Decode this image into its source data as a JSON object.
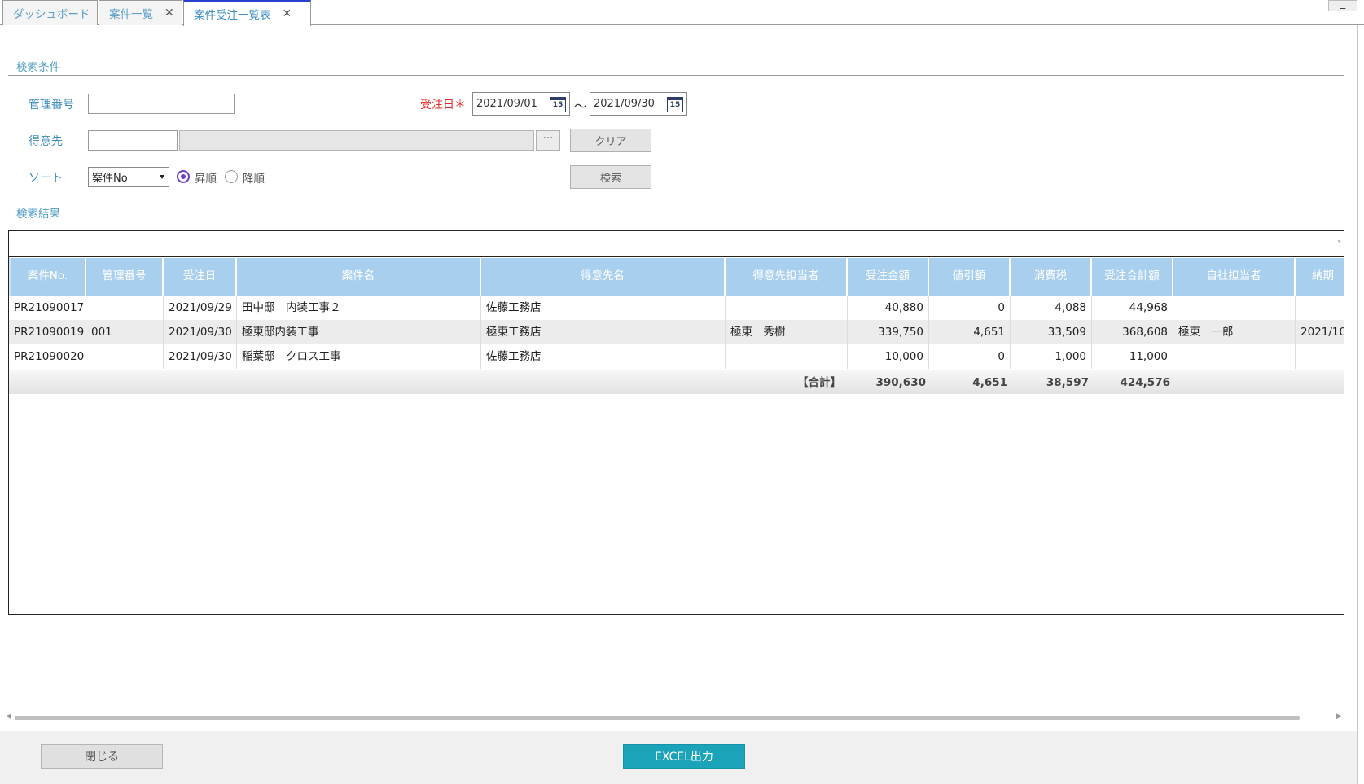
{
  "tabs": [
    {
      "label": "ダッシュボード",
      "closable": false
    },
    {
      "label": "案件一覧",
      "closable": true
    },
    {
      "label": "案件受注一覧表",
      "closable": true,
      "active": true
    }
  ],
  "window": {
    "minimize_label": "_"
  },
  "search": {
    "section_label": "検索条件",
    "mgmt_no_label": "管理番号",
    "mgmt_no_value": "",
    "order_date_label": "受注日＊",
    "date_from": "2021/09/01",
    "date_to": "2021/09/30",
    "date_separator": "～",
    "calendar_day": "15",
    "customer_label": "得意先",
    "customer_code": "",
    "customer_name": "",
    "lookup_label": "···",
    "clear_label": "クリア",
    "sort_label": "ソート",
    "sort_selected": "案件No",
    "asc_label": "昇順",
    "desc_label": "降順",
    "sort_order": "asc",
    "search_label": "検索"
  },
  "results": {
    "section_label": "検索結果",
    "topbar_mark": "ﾞ",
    "columns": [
      "案件No.",
      "管理番号",
      "受注日",
      "案件名",
      "得意先名",
      "得意先担当者",
      "受注金額",
      "値引額",
      "消費税",
      "受注合計額",
      "自社担当者",
      "納期"
    ],
    "rows": [
      [
        "PR21090017",
        "",
        "2021/09/29",
        "田中邸　内装工事２",
        "佐藤工務店",
        "",
        "40,880",
        "0",
        "4,088",
        "44,968",
        "",
        ""
      ],
      [
        "PR21090019",
        "001",
        "2021/09/30",
        "極東邸内装工事",
        "極東工務店",
        "極東　秀樹",
        "339,750",
        "4,651",
        "33,509",
        "368,608",
        "極東　一郎",
        "2021/10"
      ],
      [
        "PR21090020",
        "",
        "2021/09/30",
        "稲葉邸　クロス工事",
        "佐藤工務店",
        "",
        "10,000",
        "0",
        "1,000",
        "11,000",
        "",
        ""
      ]
    ],
    "totals": {
      "label": "【合計】",
      "order_amount": "390,630",
      "discount": "4,651",
      "tax": "38,597",
      "total": "424,576"
    }
  },
  "scrollbar": {
    "left_arrow": "◀",
    "right_arrow": "▶"
  },
  "footer": {
    "close_label": "閉じる",
    "excel_label": "EXCEL出力"
  },
  "colors": {
    "accent": "#3e8fc4",
    "header_bg": "#a9cfee",
    "required": "#e0312b",
    "excel_button": "#1ba3b9",
    "radio_checked": "#6a3fc8"
  }
}
